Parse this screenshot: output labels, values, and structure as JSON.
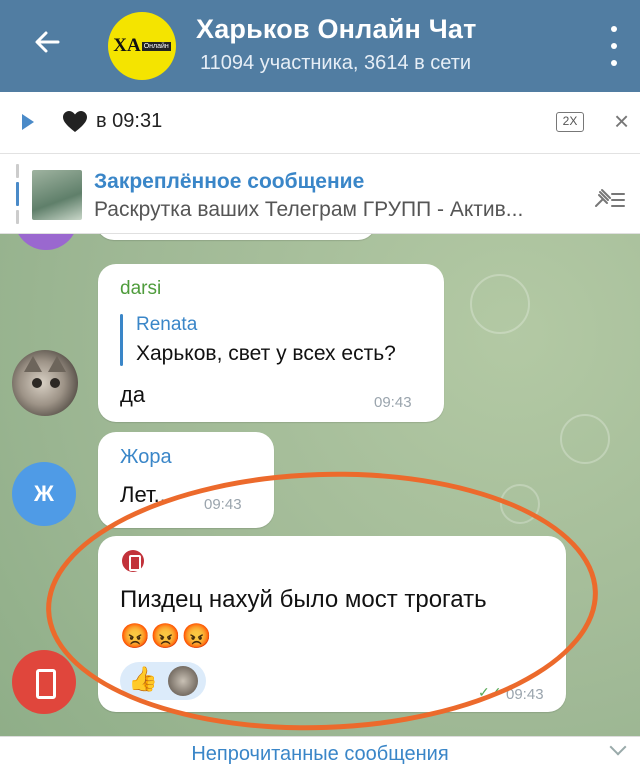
{
  "header": {
    "avatar_text": "ХА",
    "avatar_small": "Онлайн",
    "title": "Харьков Онлайн Чат",
    "subtitle": "11094 участника, 3614 в сети"
  },
  "player": {
    "text": "в 09:31",
    "speed": "2X",
    "close": "×"
  },
  "pinned": {
    "title": "Закреплённое сообщение",
    "text": "Раскрутка ваших Телеграм ГРУПП - Актив..."
  },
  "messages": [
    {
      "sender": "darsi",
      "reply_name": "Renata",
      "reply_text": "Харьков, свет у всех есть?",
      "text": "да",
      "time": "09:43"
    },
    {
      "avatar_letter": "Ж",
      "sender": "Жора",
      "text": "Лет...",
      "time": "09:43"
    },
    {
      "text": "Пиздец  нахуй было мост трогать",
      "emojis": "😡😡😡",
      "reaction": "👍",
      "time": "09:43"
    }
  ],
  "bottom": {
    "label": "Непрочитанные сообщения"
  },
  "colors": {
    "header": "#517da2",
    "accent": "#3a86c8",
    "highlight_circle": "#ec6a2c"
  }
}
